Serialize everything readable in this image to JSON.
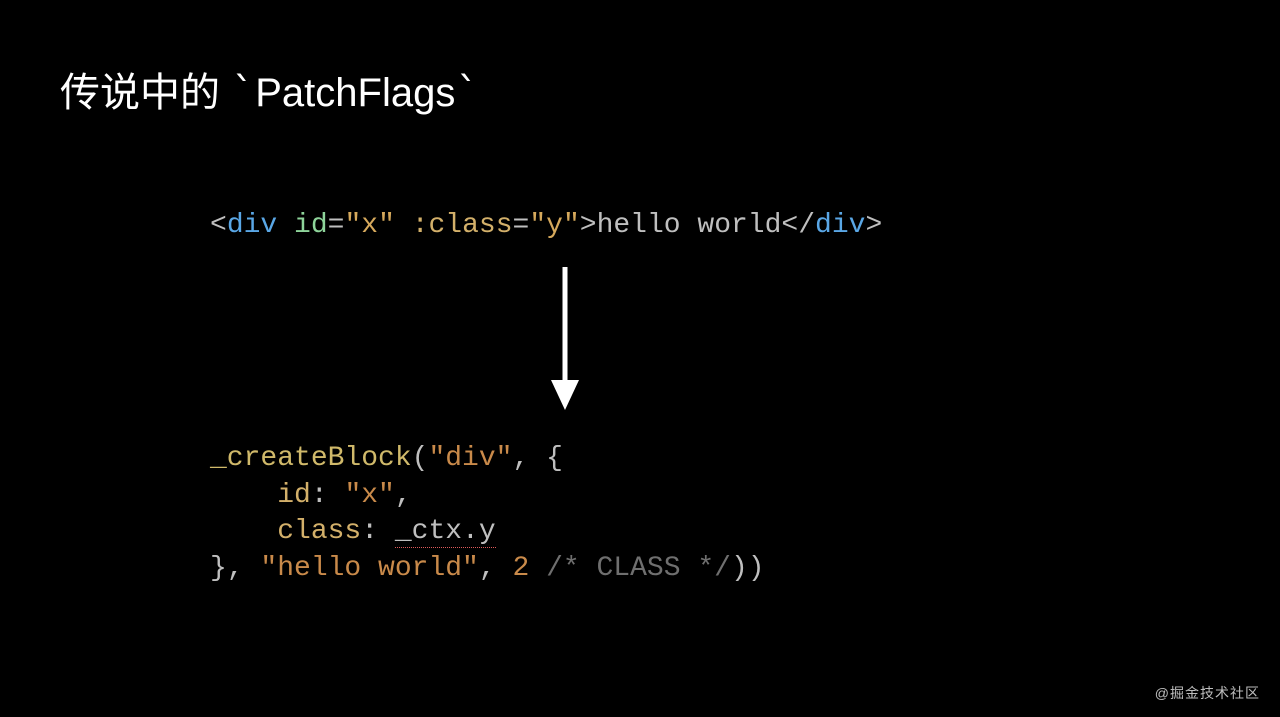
{
  "title": {
    "prefix": "传说中的 ",
    "tick1": "`",
    "name": "PatchFlags",
    "tick2": "`"
  },
  "template": {
    "lt1": "<",
    "tag_open": "div",
    "space1": " ",
    "attr_id_name": "id",
    "eq1": "=",
    "attr_id_val": "\"x\"",
    "space2": " ",
    "attr_class_name": ":class",
    "eq2": "=",
    "attr_class_val": "\"y\"",
    "gt1": ">",
    "text": "hello world",
    "lt2": "</",
    "tag_close": "div",
    "gt2": ">"
  },
  "output": {
    "l1": {
      "fn": "_createBlock",
      "open": "(",
      "arg1": "\"div\"",
      "comma": ", ",
      "brace": "{"
    },
    "l2": {
      "indent": "    ",
      "key": "id",
      "colon": ": ",
      "val": "\"x\"",
      "comma": ","
    },
    "l3": {
      "indent": "    ",
      "key": "class",
      "colon": ": ",
      "val": "_ctx.y"
    },
    "l4": {
      "brace": "}",
      "comma1": ", ",
      "str": "\"hello world\"",
      "comma2": ", ",
      "num": "2",
      "space": " ",
      "comment": "/* CLASS */",
      "close": "))"
    }
  },
  "watermark": "@掘金技术社区"
}
